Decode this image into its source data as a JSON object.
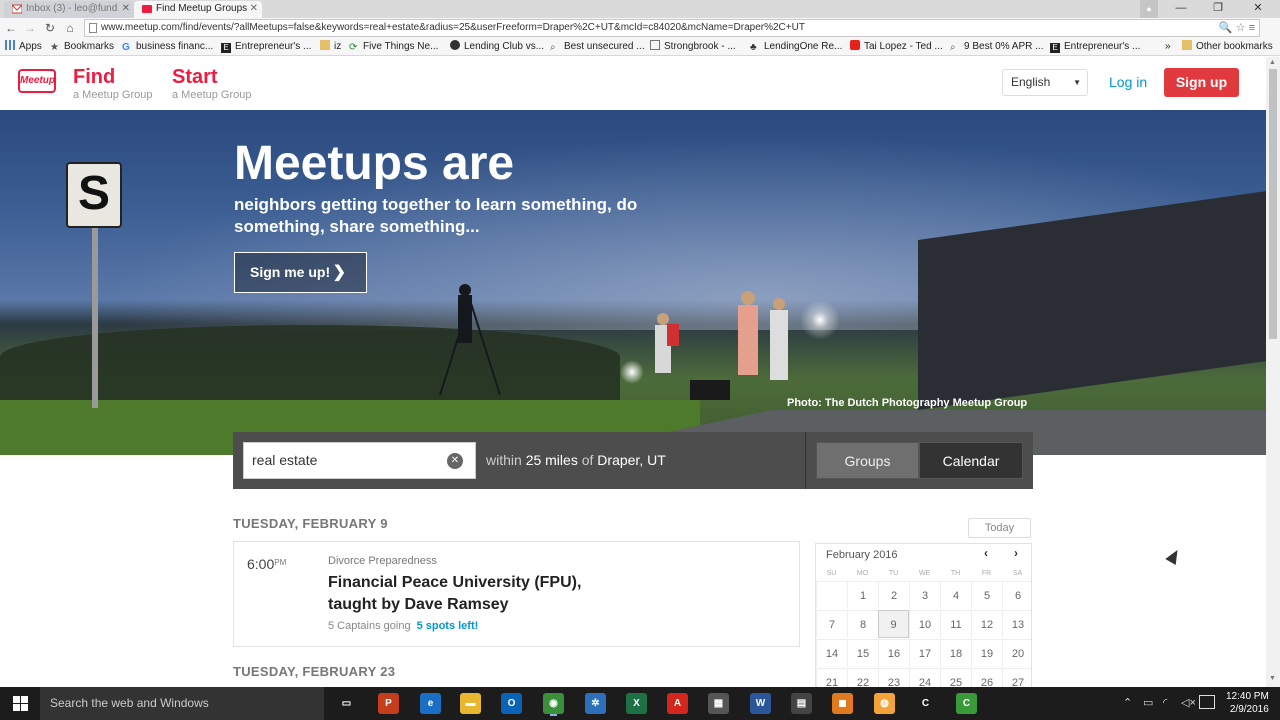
{
  "browser": {
    "tabs": [
      {
        "label": "Inbox (3) - leo@fund",
        "favicon_color": "#c8403a"
      },
      {
        "label": "Find Meetup Groups",
        "favicon_color": "#ed1c40"
      }
    ],
    "url": "www.meetup.com/find/events/?allMeetups=false&keywords=real+estate&radius=25&userFreeform=Draper%2C+UT&mcId=c84020&mcName=Draper%2C+UT",
    "bookmarks": [
      {
        "label": "Apps",
        "icon": "apps-grid-icon"
      },
      {
        "label": "Bookmarks",
        "icon": "star-icon"
      },
      {
        "label": "business financ...",
        "icon": "google-g-icon"
      },
      {
        "label": "Entrepreneur's ...",
        "icon": "e-logo-icon"
      },
      {
        "label": "iz",
        "icon": "folder-icon"
      },
      {
        "label": "Five Things Ne...",
        "icon": "refresh-logo-icon"
      },
      {
        "label": "Lending Club vs...",
        "icon": "globe-icon"
      },
      {
        "label": "Best unsecured ...",
        "icon": "search-icon"
      },
      {
        "label": "Strongbrook - ...",
        "icon": "page-icon"
      },
      {
        "label": "LendingOne Re...",
        "icon": "tree-icon"
      },
      {
        "label": "Tai Lopez - Ted ...",
        "icon": "youtube-icon"
      },
      {
        "label": "9 Best 0% APR ...",
        "icon": "search-icon"
      },
      {
        "label": "Entrepreneur's ...",
        "icon": "e-logo-icon"
      },
      {
        "label": "»",
        "icon": ""
      },
      {
        "label": "Other bookmarks",
        "icon": "folder-icon"
      }
    ]
  },
  "header": {
    "logo": "Meetup",
    "find_label": "Find",
    "find_sub": "a Meetup Group",
    "start_label": "Start",
    "start_sub": "a Meetup Group",
    "language": "English",
    "login_label": "Log in",
    "signup_label": "Sign up"
  },
  "hero": {
    "sign_letter": "S",
    "headline": "Meetups are",
    "subhead": "neighbors getting together to learn something, do something, share something...",
    "cta_label": "Sign me up!",
    "credit": "Photo: The Dutch Photography Meetup Group"
  },
  "search": {
    "keywords": "real estate",
    "within_label": "within",
    "radius": "25 miles",
    "of_label": "of",
    "location": "Draper, UT",
    "groups_label": "Groups",
    "calendar_label": "Calendar"
  },
  "results": {
    "days": [
      {
        "header": "TUESDAY, FEBRUARY 9",
        "events": [
          {
            "time": "6:00",
            "ampm": "PM",
            "group": "Divorce Preparedness",
            "title": "Financial Peace University (FPU), taught by Dave Ramsey",
            "going": "5 Captains going",
            "spots": "5 spots left!"
          }
        ]
      },
      {
        "header": "TUESDAY, FEBRUARY 23",
        "events": []
      }
    ]
  },
  "calendar": {
    "today_label": "Today",
    "month": "February 2016",
    "weekdays": [
      "SU",
      "MO",
      "TU",
      "WE",
      "TH",
      "FR",
      "SA"
    ],
    "weeks": [
      [
        "",
        "1",
        "2",
        "3",
        "4",
        "5",
        "6"
      ],
      [
        "7",
        "8",
        "9",
        "10",
        "11",
        "12",
        "13"
      ],
      [
        "14",
        "15",
        "16",
        "17",
        "18",
        "19",
        "20"
      ],
      [
        "21",
        "22",
        "23",
        "24",
        "25",
        "26",
        "27"
      ]
    ],
    "today": "9"
  },
  "taskbar": {
    "search_placeholder": "Search the web and Windows",
    "apps": [
      {
        "name": "task-view-icon",
        "label": "▭",
        "color": "#1c1c1c"
      },
      {
        "name": "powerpoint-icon",
        "label": "P",
        "color": "#c43e1c"
      },
      {
        "name": "edge-icon",
        "label": "e",
        "color": "#1a6fc4"
      },
      {
        "name": "file-explorer-icon",
        "label": "▬",
        "color": "#e8b630"
      },
      {
        "name": "outlook-icon",
        "label": "O",
        "color": "#0a63b4"
      },
      {
        "name": "chrome-icon",
        "label": "◉",
        "color": "#3b8f3b"
      },
      {
        "name": "settings-app-icon",
        "label": "✲",
        "color": "#2d6fba"
      },
      {
        "name": "excel-icon",
        "label": "X",
        "color": "#1e7145"
      },
      {
        "name": "acrobat-icon",
        "label": "A",
        "color": "#d4261c"
      },
      {
        "name": "calculator-icon",
        "label": "▦",
        "color": "#555555"
      },
      {
        "name": "word-icon",
        "label": "W",
        "color": "#2b579a"
      },
      {
        "name": "media-app-icon",
        "label": "▤",
        "color": "#444444"
      },
      {
        "name": "orange-app-icon",
        "label": "◼",
        "color": "#e07a1f"
      },
      {
        "name": "ring-central-icon",
        "label": "◍",
        "color": "#f2a33a"
      },
      {
        "name": "camtasia-icon",
        "label": "C",
        "color": "#1c1c1c"
      },
      {
        "name": "green-c-app-icon",
        "label": "C",
        "color": "#3a9a3a"
      }
    ],
    "time": "12:40 PM",
    "date": "2/9/2016"
  }
}
